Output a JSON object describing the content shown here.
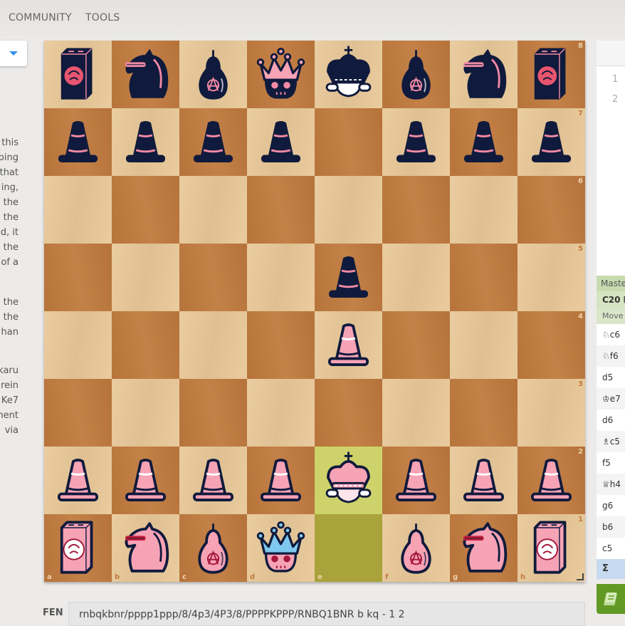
{
  "nav": {
    "items": [
      "COMMUNITY",
      "TOOLS"
    ]
  },
  "left_text_fragments": [
    "this",
    "ping",
    "that",
    "ing,",
    "the",
    "the",
    "d, it",
    "the",
    "of a",
    "the",
    "the",
    "han",
    "karu",
    "rein",
    "Ke7",
    "ment",
    "via"
  ],
  "board": {
    "fen": "rnbqkbnr/pppp1ppp/8/4p3/4P3/8/PPPPKPPP/RNBQ1BNR b kq - 1 2",
    "last_move": [
      "e1",
      "e2"
    ],
    "files": [
      "a",
      "b",
      "c",
      "d",
      "e",
      "f",
      "g",
      "h"
    ],
    "ranks": [
      "8",
      "7",
      "6",
      "5",
      "4",
      "3",
      "2",
      "1"
    ],
    "colors": {
      "light_square": "#e8c898",
      "dark_square": "#c07a3e",
      "highlight": "#cdd26a",
      "dark_piece": "#101a3c",
      "light_piece": "#f7a3b6",
      "accent": "#f28aa5"
    }
  },
  "move_list": {
    "numbers": [
      "1",
      "2"
    ]
  },
  "explorer": {
    "title": "Masters",
    "opening_eco": "C20",
    "opening_name": "B",
    "column_header": "Move",
    "moves": [
      "♘c6",
      "♘f6",
      "d5",
      "♔e7",
      "d6",
      "♗c5",
      "f5",
      "♕h4",
      "g6",
      "b6",
      "c5"
    ],
    "sum_label": "Σ"
  },
  "book_button": {
    "icon": "book-icon",
    "color": "#629924"
  },
  "fen_bar": {
    "label": "FEN",
    "value": "rnbqkbnr/pppp1ppp/8/4p3/4P3/8/PPPPKPPP/RNBQ1BNR b kq - 1 2"
  }
}
